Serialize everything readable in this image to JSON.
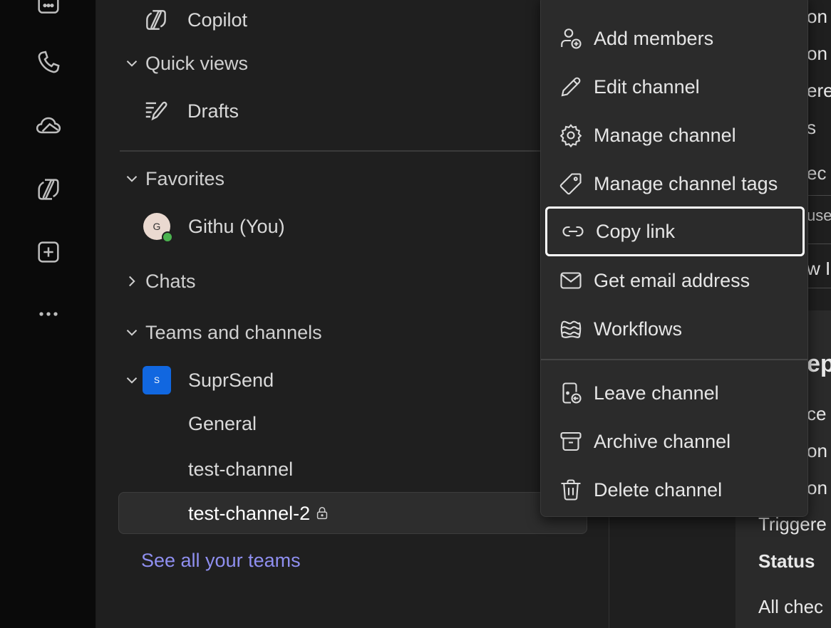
{
  "sidebar": {
    "copilot": "Copilot",
    "quick_views": "Quick views",
    "drafts": "Drafts",
    "favorites": "Favorites",
    "favorite_user": "Githu (You)",
    "favorite_initial": "G",
    "chats": "Chats",
    "teams_and_channels": "Teams and channels",
    "team_name": "SuprSend",
    "team_initial": "S",
    "channels": [
      "General",
      "test-channel",
      "test-channel-2"
    ],
    "see_all": "See all your teams"
  },
  "rail_icons": [
    "calendar-icon",
    "phone-icon",
    "onedrive-icon",
    "copilot-icon",
    "add-app-icon",
    "more-icon"
  ],
  "context_menu": {
    "items": [
      {
        "label": "Add members",
        "icon": "add-person-icon"
      },
      {
        "label": "Edit channel",
        "icon": "pencil-icon"
      },
      {
        "label": "Manage channel",
        "icon": "gear-icon"
      },
      {
        "label": "Manage channel tags",
        "icon": "tag-icon"
      },
      {
        "label": "Copy link",
        "icon": "link-icon"
      },
      {
        "label": "Get email address",
        "icon": "mail-icon"
      },
      {
        "label": "Workflows",
        "icon": "workflows-icon"
      },
      {
        "label": "Leave channel",
        "icon": "leave-icon"
      },
      {
        "label": "Archive channel",
        "icon": "archive-icon"
      },
      {
        "label": "Delete channel",
        "icon": "trash-icon"
      }
    ]
  },
  "background_fragments": {
    "frag1": "on",
    "frag2": "on",
    "frag3": "ere",
    "frag4": "s",
    "frag5": "ec",
    "frag6": "use",
    "frag7": "w I",
    "frag8": "ep",
    "frag9": "ce",
    "frag10": "on",
    "frag11": "on",
    "triggered": "Triggere",
    "status": "Status",
    "all_checks": "All chec"
  },
  "colors": {
    "accent_link": "#8f8ff0",
    "team_badge": "#1167e0",
    "presence": "#4bb34f"
  }
}
